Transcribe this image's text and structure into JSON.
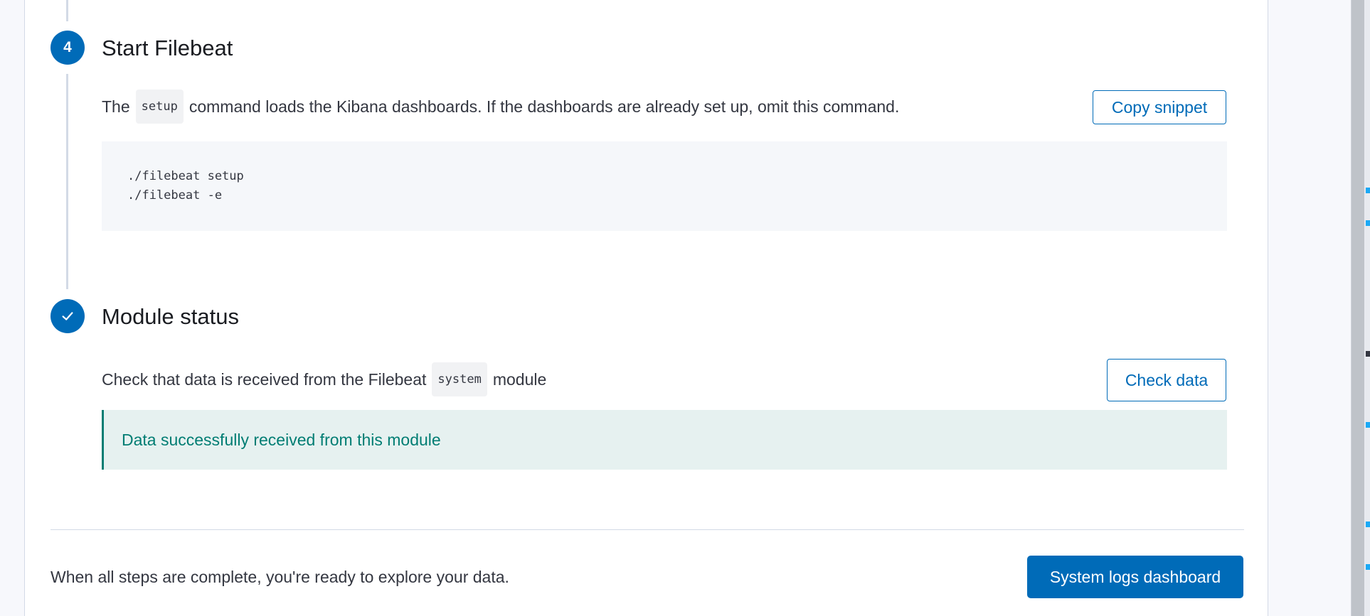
{
  "steps": {
    "start_filebeat": {
      "number": "4",
      "title": "Start Filebeat",
      "desc_before": "The",
      "desc_code": "setup",
      "desc_after": "command loads the Kibana dashboards. If the dashboards are already set up, omit this command.",
      "copy_button": "Copy snippet",
      "code_lines": [
        "./filebeat setup",
        "./filebeat -e"
      ]
    },
    "module_status": {
      "title": "Module status",
      "badge_icon": "checkmark-icon",
      "desc_before": "Check that data is received from the Filebeat",
      "desc_code": "system",
      "desc_after": "module",
      "check_button": "Check data",
      "success_message": "Data successfully received from this module"
    }
  },
  "footer": {
    "text": "When all steps are complete, you're ready to explore your data.",
    "button": "System logs dashboard"
  },
  "colors": {
    "primary": "#006bb8",
    "success": "#017d73",
    "success_bg": "#e6f1f0"
  }
}
